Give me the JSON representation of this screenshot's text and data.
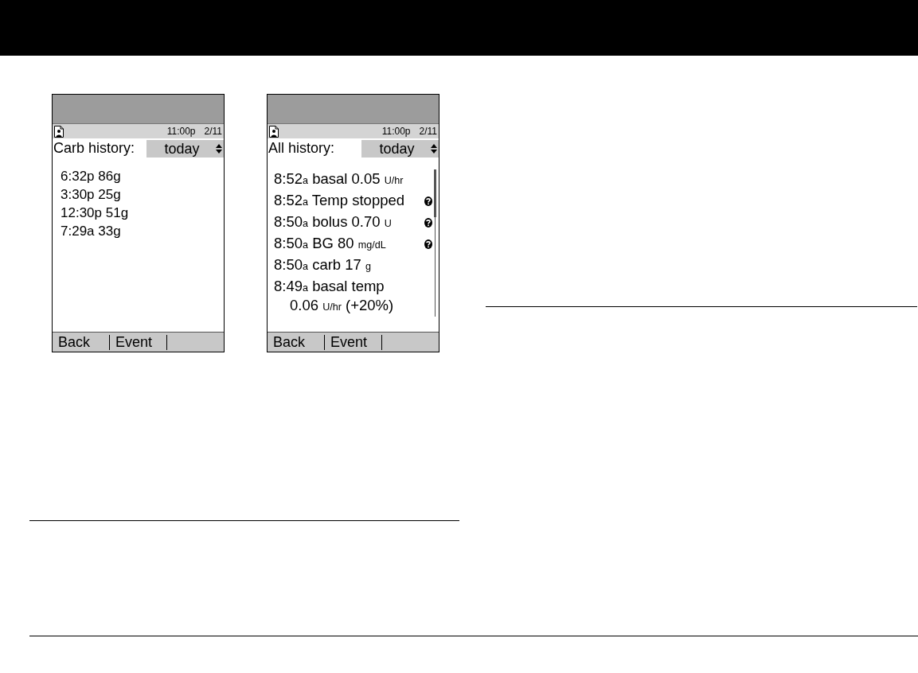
{
  "screens": [
    {
      "status": {
        "time": "11:00p",
        "date": "2/11"
      },
      "title": "Carb history:",
      "filter": "today",
      "scrollbar": false,
      "entries": [
        {
          "info": false,
          "lines": [
            [
              {
                "text": "6:32p 86g",
                "kind": "plain"
              }
            ]
          ]
        },
        {
          "info": false,
          "lines": [
            [
              {
                "text": "3:30p 25g",
                "kind": "plain"
              }
            ]
          ]
        },
        {
          "info": false,
          "lines": [
            [
              {
                "text": "12:30p 51g",
                "kind": "plain"
              }
            ]
          ]
        },
        {
          "info": false,
          "lines": [
            [
              {
                "text": "7:29a 33g",
                "kind": "plain"
              }
            ]
          ]
        }
      ],
      "softkeys": [
        "Back",
        "Event"
      ]
    },
    {
      "status": {
        "time": "11:00p",
        "date": "2/11"
      },
      "title": "All history:",
      "filter": "today",
      "scrollbar": true,
      "entries": [
        {
          "info": false,
          "lines": [
            [
              {
                "text": "8:52",
                "kind": "plain"
              },
              {
                "text": "a",
                "kind": "small"
              },
              {
                "text": " basal 0.05 ",
                "kind": "plain"
              },
              {
                "text": "U/hr",
                "kind": "small"
              }
            ]
          ]
        },
        {
          "info": true,
          "lines": [
            [
              {
                "text": "8:52",
                "kind": "plain"
              },
              {
                "text": "a",
                "kind": "small"
              },
              {
                "text": " Temp stopped",
                "kind": "plain"
              }
            ]
          ]
        },
        {
          "info": true,
          "lines": [
            [
              {
                "text": "8:50",
                "kind": "plain"
              },
              {
                "text": "a",
                "kind": "small"
              },
              {
                "text": " bolus 0.70 ",
                "kind": "plain"
              },
              {
                "text": "U",
                "kind": "small"
              }
            ]
          ]
        },
        {
          "info": true,
          "lines": [
            [
              {
                "text": "8:50",
                "kind": "plain"
              },
              {
                "text": "a",
                "kind": "small"
              },
              {
                "text": " BG 80 ",
                "kind": "plain"
              },
              {
                "text": "mg/dL",
                "kind": "small"
              }
            ]
          ]
        },
        {
          "info": false,
          "lines": [
            [
              {
                "text": "8:50",
                "kind": "plain"
              },
              {
                "text": "a",
                "kind": "small"
              },
              {
                "text": " carb 17 ",
                "kind": "plain"
              },
              {
                "text": "g",
                "kind": "small"
              }
            ]
          ]
        },
        {
          "info": false,
          "lines": [
            [
              {
                "text": "8:49",
                "kind": "plain"
              },
              {
                "text": "a",
                "kind": "small"
              },
              {
                "text": " basal temp",
                "kind": "plain"
              }
            ],
            [
              {
                "text": "0.06 ",
                "kind": "plain"
              },
              {
                "text": "U/hr",
                "kind": "small"
              },
              {
                "text": " (+20%)",
                "kind": "plain"
              }
            ]
          ]
        }
      ],
      "softkeys": [
        "Back",
        "Event"
      ]
    }
  ]
}
